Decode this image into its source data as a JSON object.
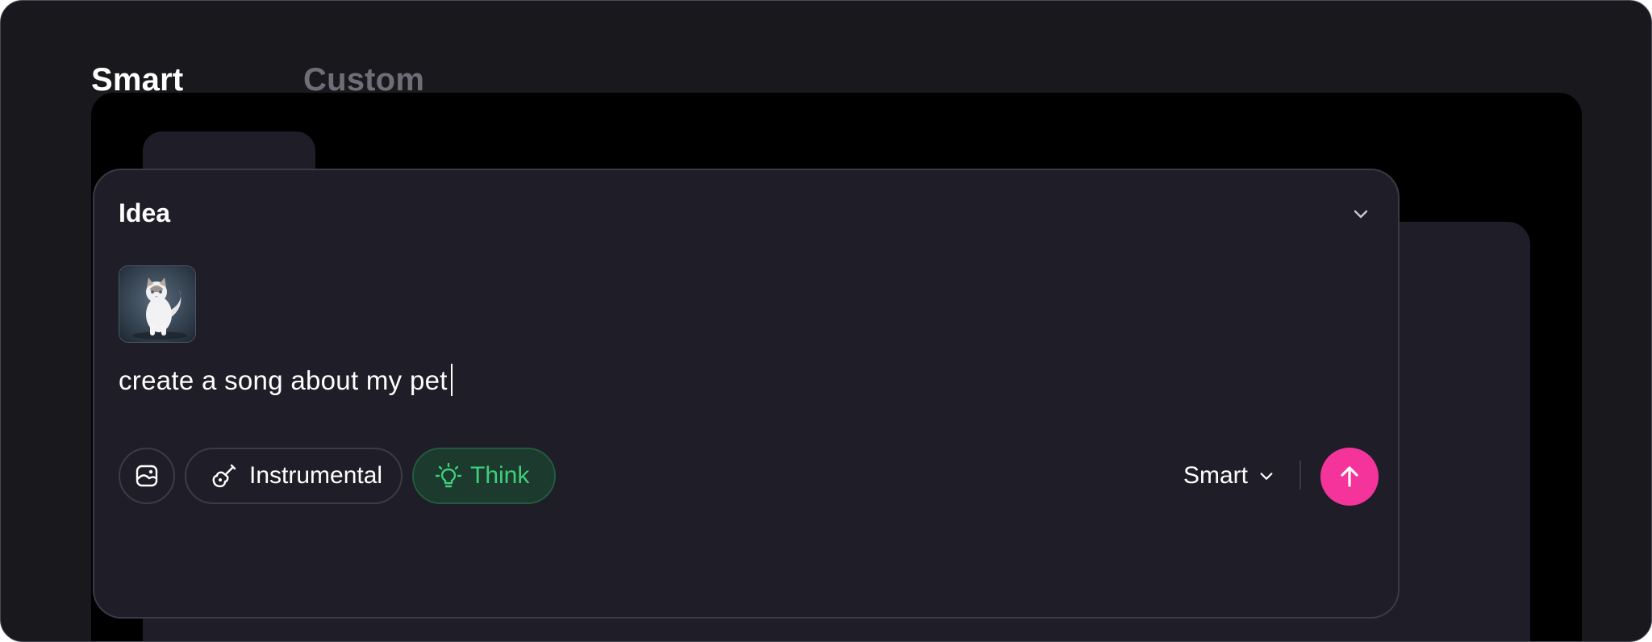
{
  "tabs": [
    {
      "label": "Smart",
      "active": true
    },
    {
      "label": "Custom",
      "active": false
    }
  ],
  "card": {
    "title": "Idea",
    "prompt": "create a song about my pet",
    "attachment_icon": "cat-photo-thumbnail"
  },
  "toolbar": {
    "image_button_icon": "image-icon",
    "instrumental_label": "Instrumental",
    "instrumental_icon": "guitar-icon",
    "think_label": "Think",
    "think_icon": "lightbulb-icon",
    "mode_label": "Smart",
    "send_icon": "arrow-up-icon"
  },
  "colors": {
    "accent_send": "#f4349b",
    "think_green": "#3ecf7b",
    "panel_bg": "#1f1e28"
  }
}
